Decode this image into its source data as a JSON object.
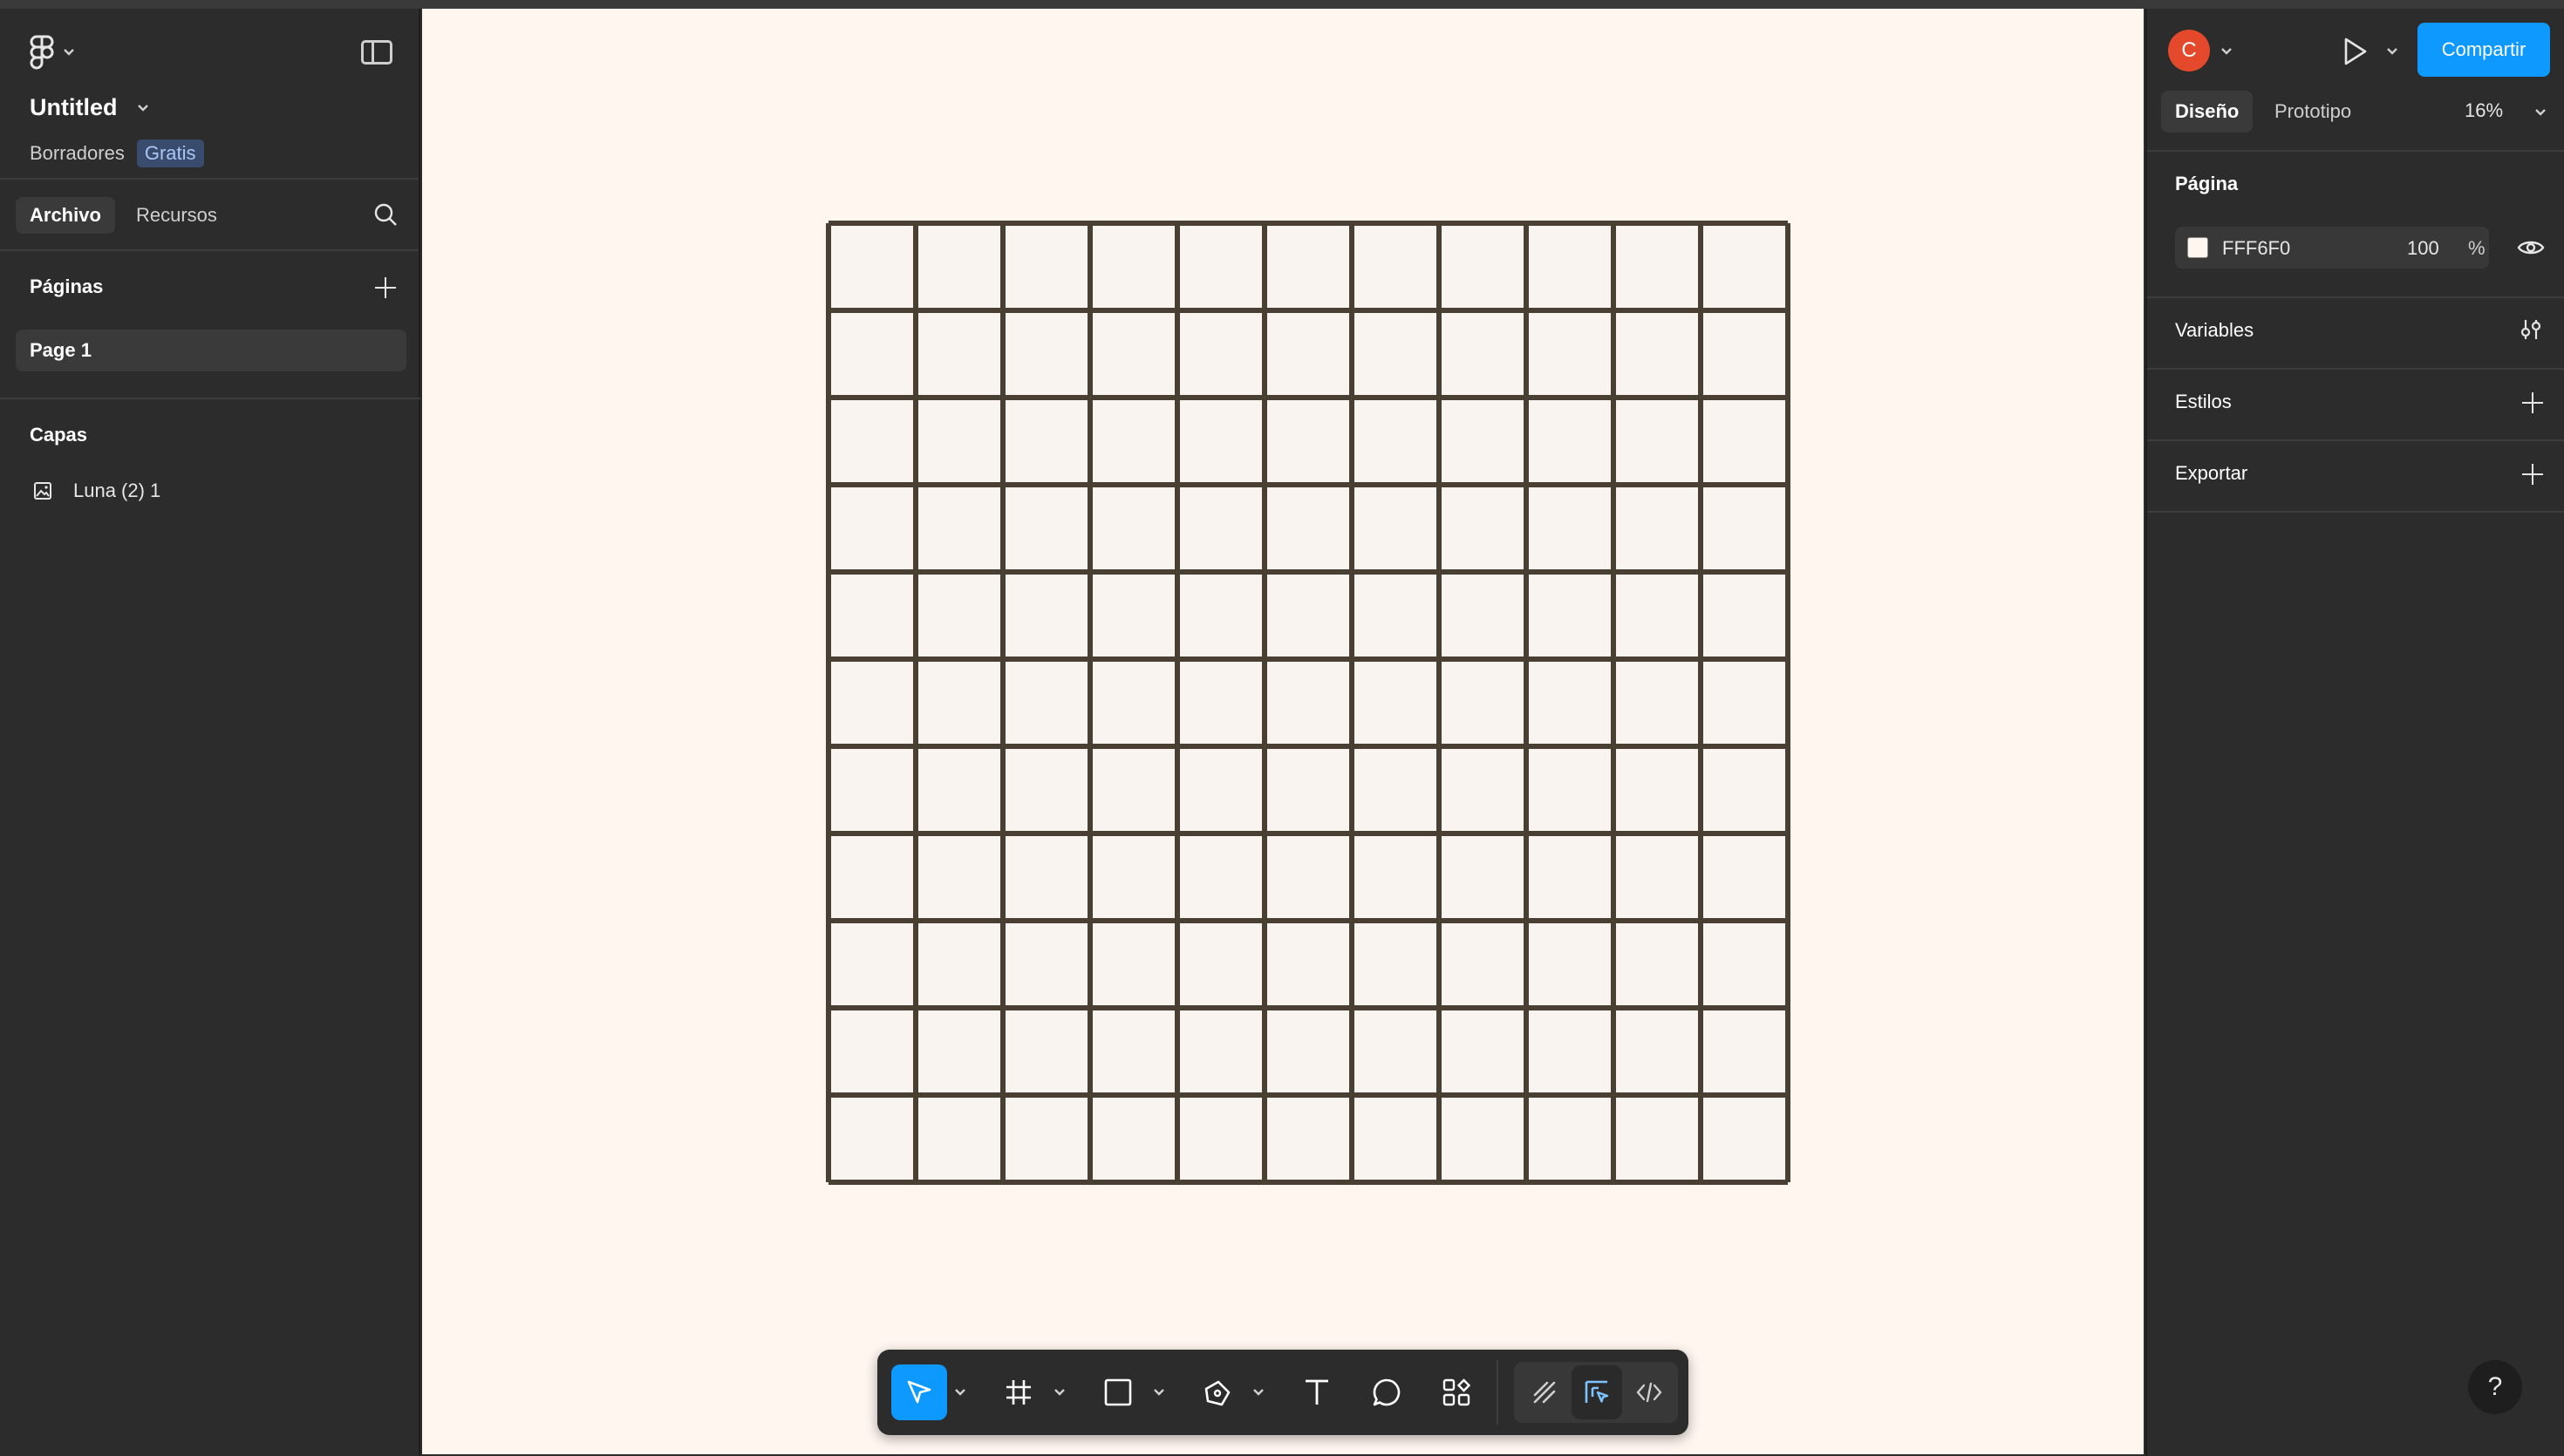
{
  "file": {
    "title": "Untitled",
    "location": "Borradores",
    "plan_badge": "Gratis"
  },
  "left_tabs": {
    "file": "Archivo",
    "assets": "Recursos"
  },
  "pages": {
    "title": "Páginas",
    "items": [
      "Page 1"
    ]
  },
  "layers": {
    "title": "Capas",
    "items": [
      {
        "name": "Luna (2) 1",
        "icon": "image-icon"
      }
    ]
  },
  "canvas": {
    "background": "#FFF6F0",
    "grid": {
      "rows": 11,
      "cols": 11,
      "line_color": "#4a3f33",
      "cell_color": "#f9f4f0"
    }
  },
  "toolbar": {
    "tools": [
      "move-icon",
      "frame-icon",
      "rectangle-icon",
      "pen-icon",
      "text-icon",
      "comment-icon",
      "actions-icon"
    ],
    "modes": [
      "draw-icon",
      "design-icon",
      "dev-mode-icon"
    ]
  },
  "right": {
    "avatar_letter": "C",
    "share_label": "Compartir",
    "tabs": {
      "design": "Diseño",
      "prototype": "Prototipo"
    },
    "zoom": "16%",
    "page_section": {
      "title": "Página",
      "color_hex": "FFF6F0",
      "opacity": "100",
      "opacity_unit": "%"
    },
    "variables_title": "Variables",
    "styles_title": "Estilos",
    "export_title": "Exportar",
    "help_label": "?"
  }
}
